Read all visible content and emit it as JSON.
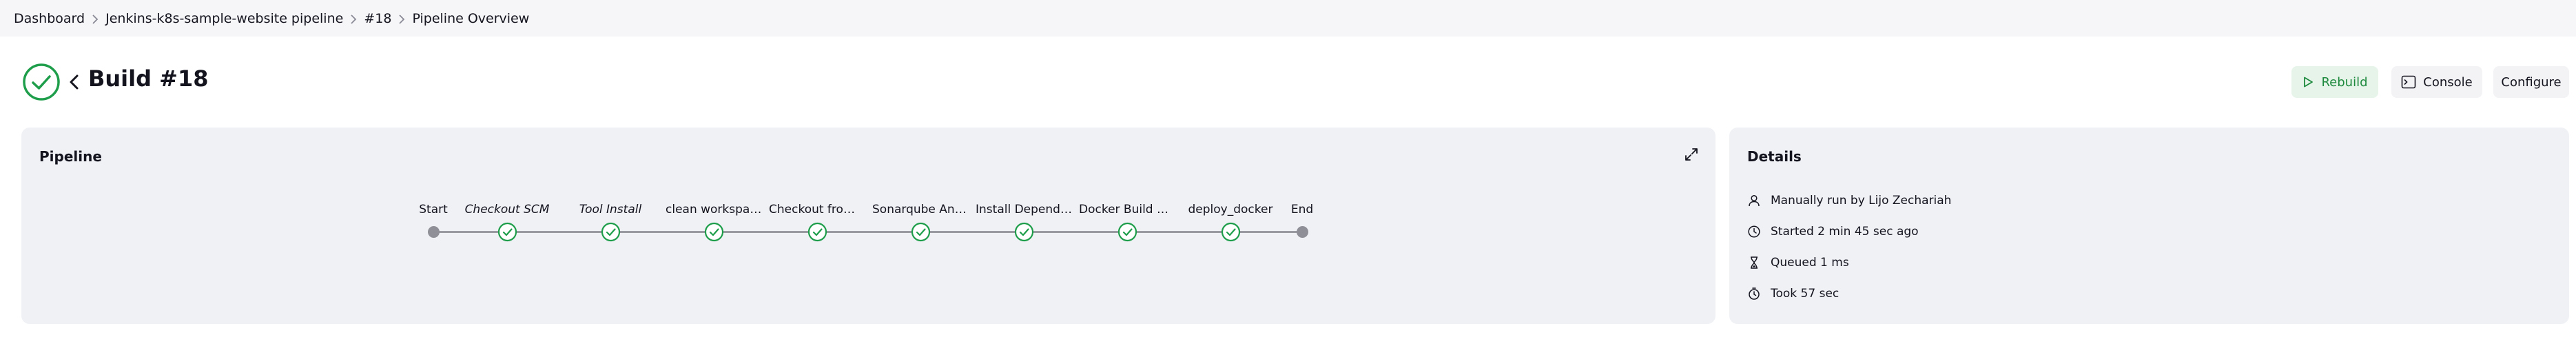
{
  "breadcrumb": {
    "items": [
      "Dashboard",
      "Jenkins-k8s-sample-website pipeline",
      "#18",
      "Pipeline Overview"
    ]
  },
  "header": {
    "title": "Build #18",
    "status": "success",
    "buttons": {
      "rebuild": "Rebuild",
      "console": "Console",
      "configure": "Configure"
    }
  },
  "pipeline": {
    "title": "Pipeline",
    "stages": [
      {
        "label": "Start",
        "kind": "terminal",
        "italic": false
      },
      {
        "label": "Checkout SCM",
        "kind": "stage",
        "status": "success",
        "italic": true
      },
      {
        "label": "Tool Install",
        "kind": "stage",
        "status": "success",
        "italic": true
      },
      {
        "label": "clean workspace",
        "kind": "stage",
        "status": "success",
        "italic": false
      },
      {
        "label": "Checkout from …",
        "kind": "stage",
        "status": "success",
        "italic": false
      },
      {
        "label": "Sonarqube Ana…",
        "kind": "stage",
        "status": "success",
        "italic": false
      },
      {
        "label": "Install Depend…",
        "kind": "stage",
        "status": "success",
        "italic": false
      },
      {
        "label": "Docker Build & …",
        "kind": "stage",
        "status": "success",
        "italic": false
      },
      {
        "label": "deploy_docker",
        "kind": "stage",
        "status": "success",
        "italic": false
      },
      {
        "label": "End",
        "kind": "terminal",
        "italic": false
      }
    ]
  },
  "details": {
    "title": "Details",
    "items": [
      {
        "icon": "person-icon",
        "text": "Manually run by Lijo Zechariah"
      },
      {
        "icon": "clock-icon",
        "text": "Started 2 min 45 sec ago"
      },
      {
        "icon": "hourglass-icon",
        "text": "Queued 1 ms"
      },
      {
        "icon": "timer-icon",
        "text": "Took 57 sec"
      }
    ]
  },
  "colors": {
    "success": "#1e9e4a",
    "rebuild_bg": "#e6f4ea",
    "panel_bg": "#eff1f5",
    "breadcrumb_bg": "#f6f6f8"
  }
}
